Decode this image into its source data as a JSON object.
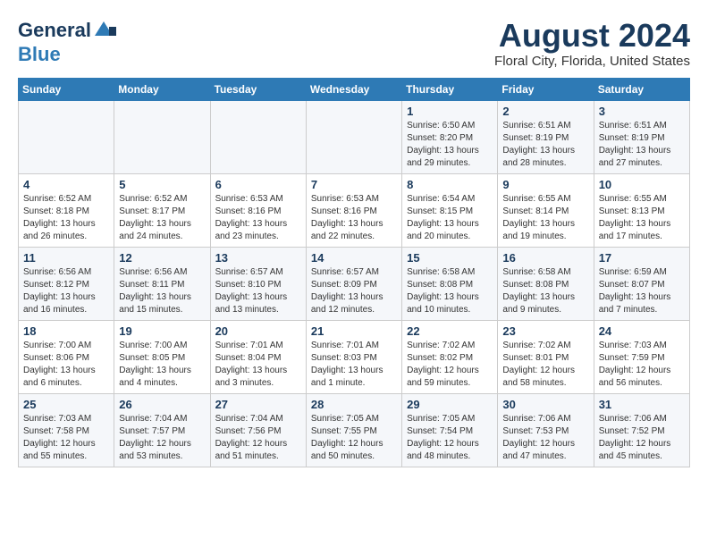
{
  "logo": {
    "part1": "General",
    "part2": "Blue"
  },
  "header": {
    "title": "August 2024",
    "subtitle": "Floral City, Florida, United States"
  },
  "days_of_week": [
    "Sunday",
    "Monday",
    "Tuesday",
    "Wednesday",
    "Thursday",
    "Friday",
    "Saturday"
  ],
  "weeks": [
    [
      {
        "num": "",
        "info": ""
      },
      {
        "num": "",
        "info": ""
      },
      {
        "num": "",
        "info": ""
      },
      {
        "num": "",
        "info": ""
      },
      {
        "num": "1",
        "info": "Sunrise: 6:50 AM\nSunset: 8:20 PM\nDaylight: 13 hours\nand 29 minutes."
      },
      {
        "num": "2",
        "info": "Sunrise: 6:51 AM\nSunset: 8:19 PM\nDaylight: 13 hours\nand 28 minutes."
      },
      {
        "num": "3",
        "info": "Sunrise: 6:51 AM\nSunset: 8:19 PM\nDaylight: 13 hours\nand 27 minutes."
      }
    ],
    [
      {
        "num": "4",
        "info": "Sunrise: 6:52 AM\nSunset: 8:18 PM\nDaylight: 13 hours\nand 26 minutes."
      },
      {
        "num": "5",
        "info": "Sunrise: 6:52 AM\nSunset: 8:17 PM\nDaylight: 13 hours\nand 24 minutes."
      },
      {
        "num": "6",
        "info": "Sunrise: 6:53 AM\nSunset: 8:16 PM\nDaylight: 13 hours\nand 23 minutes."
      },
      {
        "num": "7",
        "info": "Sunrise: 6:53 AM\nSunset: 8:16 PM\nDaylight: 13 hours\nand 22 minutes."
      },
      {
        "num": "8",
        "info": "Sunrise: 6:54 AM\nSunset: 8:15 PM\nDaylight: 13 hours\nand 20 minutes."
      },
      {
        "num": "9",
        "info": "Sunrise: 6:55 AM\nSunset: 8:14 PM\nDaylight: 13 hours\nand 19 minutes."
      },
      {
        "num": "10",
        "info": "Sunrise: 6:55 AM\nSunset: 8:13 PM\nDaylight: 13 hours\nand 17 minutes."
      }
    ],
    [
      {
        "num": "11",
        "info": "Sunrise: 6:56 AM\nSunset: 8:12 PM\nDaylight: 13 hours\nand 16 minutes."
      },
      {
        "num": "12",
        "info": "Sunrise: 6:56 AM\nSunset: 8:11 PM\nDaylight: 13 hours\nand 15 minutes."
      },
      {
        "num": "13",
        "info": "Sunrise: 6:57 AM\nSunset: 8:10 PM\nDaylight: 13 hours\nand 13 minutes."
      },
      {
        "num": "14",
        "info": "Sunrise: 6:57 AM\nSunset: 8:09 PM\nDaylight: 13 hours\nand 12 minutes."
      },
      {
        "num": "15",
        "info": "Sunrise: 6:58 AM\nSunset: 8:08 PM\nDaylight: 13 hours\nand 10 minutes."
      },
      {
        "num": "16",
        "info": "Sunrise: 6:58 AM\nSunset: 8:08 PM\nDaylight: 13 hours\nand 9 minutes."
      },
      {
        "num": "17",
        "info": "Sunrise: 6:59 AM\nSunset: 8:07 PM\nDaylight: 13 hours\nand 7 minutes."
      }
    ],
    [
      {
        "num": "18",
        "info": "Sunrise: 7:00 AM\nSunset: 8:06 PM\nDaylight: 13 hours\nand 6 minutes."
      },
      {
        "num": "19",
        "info": "Sunrise: 7:00 AM\nSunset: 8:05 PM\nDaylight: 13 hours\nand 4 minutes."
      },
      {
        "num": "20",
        "info": "Sunrise: 7:01 AM\nSunset: 8:04 PM\nDaylight: 13 hours\nand 3 minutes."
      },
      {
        "num": "21",
        "info": "Sunrise: 7:01 AM\nSunset: 8:03 PM\nDaylight: 13 hours\nand 1 minute."
      },
      {
        "num": "22",
        "info": "Sunrise: 7:02 AM\nSunset: 8:02 PM\nDaylight: 12 hours\nand 59 minutes."
      },
      {
        "num": "23",
        "info": "Sunrise: 7:02 AM\nSunset: 8:01 PM\nDaylight: 12 hours\nand 58 minutes."
      },
      {
        "num": "24",
        "info": "Sunrise: 7:03 AM\nSunset: 7:59 PM\nDaylight: 12 hours\nand 56 minutes."
      }
    ],
    [
      {
        "num": "25",
        "info": "Sunrise: 7:03 AM\nSunset: 7:58 PM\nDaylight: 12 hours\nand 55 minutes."
      },
      {
        "num": "26",
        "info": "Sunrise: 7:04 AM\nSunset: 7:57 PM\nDaylight: 12 hours\nand 53 minutes."
      },
      {
        "num": "27",
        "info": "Sunrise: 7:04 AM\nSunset: 7:56 PM\nDaylight: 12 hours\nand 51 minutes."
      },
      {
        "num": "28",
        "info": "Sunrise: 7:05 AM\nSunset: 7:55 PM\nDaylight: 12 hours\nand 50 minutes."
      },
      {
        "num": "29",
        "info": "Sunrise: 7:05 AM\nSunset: 7:54 PM\nDaylight: 12 hours\nand 48 minutes."
      },
      {
        "num": "30",
        "info": "Sunrise: 7:06 AM\nSunset: 7:53 PM\nDaylight: 12 hours\nand 47 minutes."
      },
      {
        "num": "31",
        "info": "Sunrise: 7:06 AM\nSunset: 7:52 PM\nDaylight: 12 hours\nand 45 minutes."
      }
    ]
  ]
}
